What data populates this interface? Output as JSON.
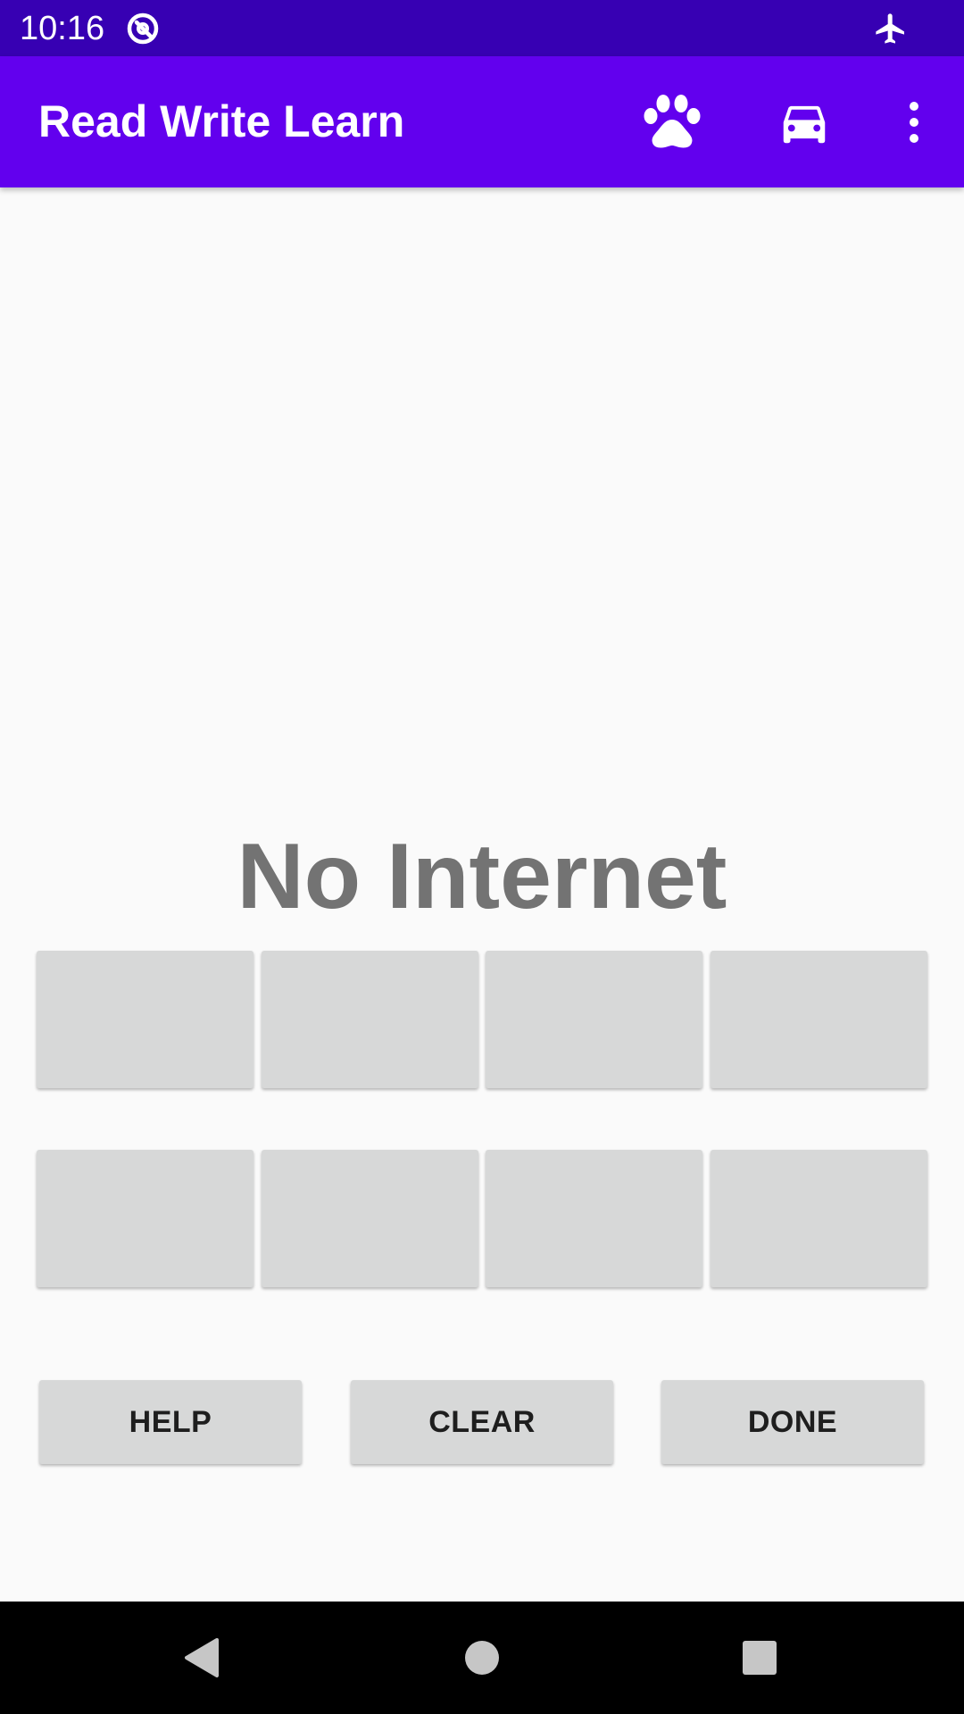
{
  "status_bar": {
    "time": "10:16",
    "icons": [
      "app-notification-icon",
      "airplane-mode-icon"
    ]
  },
  "app_bar": {
    "title": "Read Write Learn",
    "actions": [
      "paw-icon",
      "car-icon",
      "overflow-menu-icon"
    ]
  },
  "main": {
    "message": "No Internet",
    "tiles_row_1": [
      "",
      "",
      "",
      ""
    ],
    "tiles_row_2": [
      "",
      "",
      "",
      ""
    ]
  },
  "buttons": {
    "help": "HELP",
    "clear": "CLEAR",
    "done": "DONE"
  },
  "nav_bar": {
    "icons": [
      "back-icon",
      "home-icon",
      "recents-icon"
    ]
  },
  "colors": {
    "status_bar": "#3700B3",
    "app_bar": "#6200EE",
    "background": "#FAFAFA",
    "tile": "#D7D8D8",
    "message_text": "#737373"
  }
}
